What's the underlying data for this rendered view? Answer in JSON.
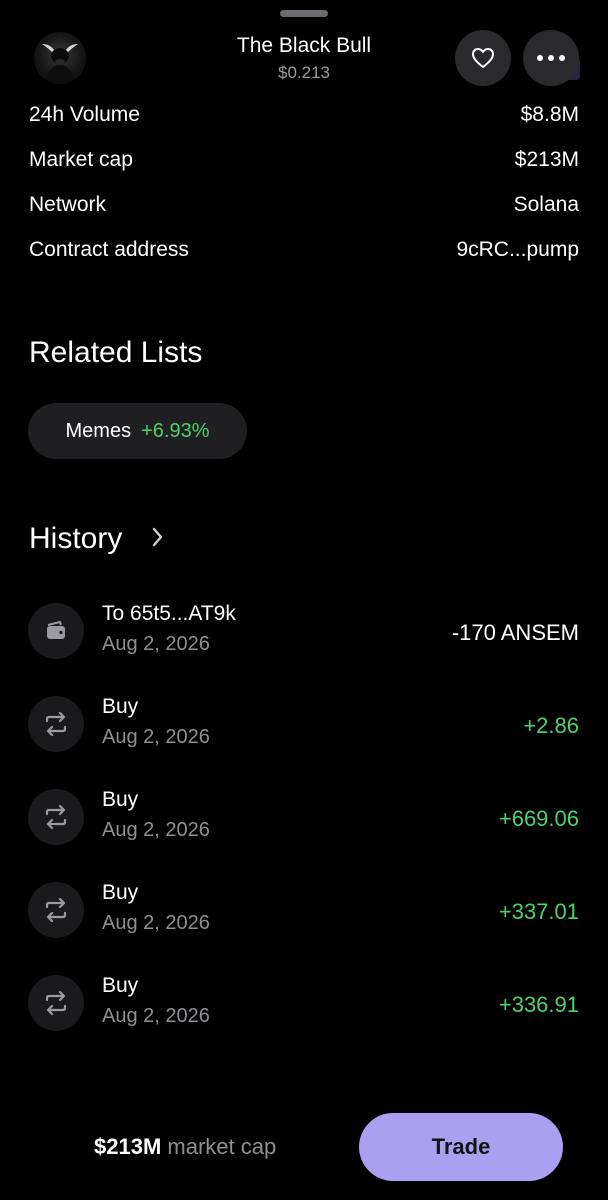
{
  "header": {
    "title": "The Black Bull",
    "price": "$0.213"
  },
  "stats": [
    {
      "label": "24h Volume",
      "value": "$8.8M"
    },
    {
      "label": "Market cap",
      "value": "$213M"
    },
    {
      "label": "Network",
      "value": "Solana"
    },
    {
      "label": "Contract address",
      "value": "9cRC...pump"
    }
  ],
  "related_lists": {
    "title": "Related Lists",
    "chips": [
      {
        "name": "Memes",
        "change": "+6.93%"
      }
    ]
  },
  "history": {
    "title": "History",
    "items": [
      {
        "title": "To 65t5...AT9k",
        "date": "Aug 2, 2026",
        "amount": "-170 ANSEM",
        "icon": "wallet-icon"
      },
      {
        "title": "Buy",
        "date": "Aug 2, 2026",
        "amount": "+2.86",
        "icon": "swap-icon"
      },
      {
        "title": "Buy",
        "date": "Aug 2, 2026",
        "amount": "+669.06",
        "icon": "swap-icon"
      },
      {
        "title": "Buy",
        "date": "Aug 2, 2026",
        "amount": "+337.01",
        "icon": "swap-icon"
      },
      {
        "title": "Buy",
        "date": "Aug 2, 2026",
        "amount": "+336.91",
        "icon": "swap-icon"
      }
    ]
  },
  "bottom": {
    "market_cap_value": "$213M",
    "market_cap_label": "market cap",
    "trade_label": "Trade"
  },
  "icons": {
    "avatar": "bull-avatar-icon",
    "favorite": "heart-icon",
    "more": "more-dots-icon",
    "chevron": "chevron-right-icon"
  },
  "colors": {
    "background": "#000000",
    "positive": "#4fd16a",
    "accent": "#ab9ff2",
    "muted": "#8e8e93"
  }
}
